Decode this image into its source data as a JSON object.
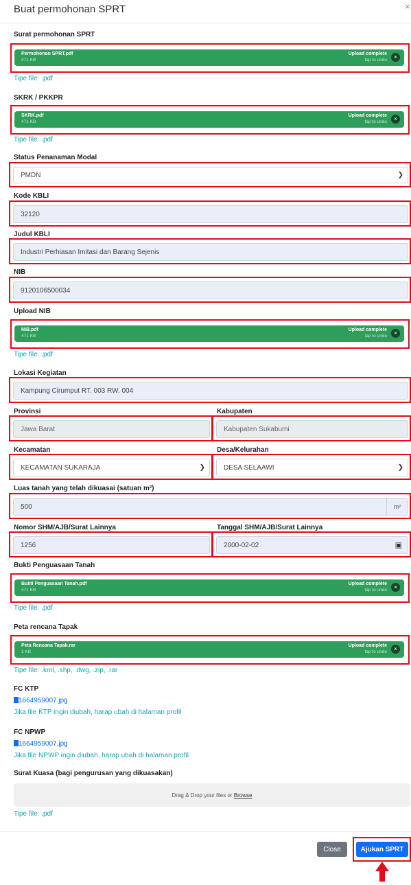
{
  "modal": {
    "title": "Buat permohonan SPRT",
    "close_glyph": "×"
  },
  "upload_status": "Upload complete",
  "undo_text": "tap to undo",
  "remove_glyph": "×",
  "surat": {
    "label": "Surat permohonan SPRT",
    "file": "Permohonan SPRT.pdf",
    "size": "471 KB",
    "hint": "Tipe file: .pdf"
  },
  "skrk": {
    "label": "SKRK / PKKPR",
    "file": "SKRK.pdf",
    "size": "471 KB",
    "hint": "Tipe file: .pdf"
  },
  "status_modal": {
    "label": "Status Penanaman Modal",
    "value": "PMDN"
  },
  "kode_kbli": {
    "label": "Kode KBLI",
    "value": "32120"
  },
  "judul_kbli": {
    "label": "Judul KBLI",
    "value": "Industri Perhiasan Imitasi dan Barang Sejenis"
  },
  "nib": {
    "label": "NIB",
    "value": "9120106500034"
  },
  "upload_nib": {
    "label": "Upload NIB",
    "file": "NIB.pdf",
    "size": "471 KB",
    "hint": "Tipe file: .pdf"
  },
  "lokasi": {
    "label": "Lokasi Kegiatan",
    "value": "Kampung Cirumput RT. 003 RW. 004"
  },
  "provinsi": {
    "label": "Provinsi",
    "value": "Jawa Barat"
  },
  "kabupaten": {
    "label": "Kabupaten",
    "value": "Kabupaten Sukabumi"
  },
  "kecamatan": {
    "label": "Kecamatan",
    "value": "KECAMATAN SUKARAJA"
  },
  "desa": {
    "label": "Desa/Kelurahan",
    "value": "DESA SELAAWI"
  },
  "luas": {
    "label": "Luas tanah yang telah dikuasai (satuan m²)",
    "value": "500",
    "unit": "m²"
  },
  "nomor_shm": {
    "label": "Nomor SHM/AJB/Surat Lainnya",
    "value": "1256"
  },
  "tanggal_shm": {
    "label": "Tanggal SHM/AJB/Surat Lainnya",
    "value": "2000-02-02"
  },
  "bukti": {
    "label": "Bukti Penguasaan Tanah",
    "file": "Bukti Penguasaan Tanah.pdf",
    "size": "471 KB",
    "hint": "Tipe file: .pdf"
  },
  "peta": {
    "label": "Peta rencana Tapak",
    "file": "Peta Rencana Tapak.rar",
    "size": "1 KB",
    "hint": "Tipe file: .kml, .shp, .dwg, .zip, .rar"
  },
  "fc_ktp": {
    "label": "FC KTP",
    "file": "1664959007.jpg",
    "note": "Jika file KTP ingin diubah, harap ubah di halaman profil"
  },
  "fc_npwp": {
    "label": "FC NPWP",
    "file": "1664959007.jpg",
    "note": "Jika file NPWP ingin diubah, harap ubah di halaman profil"
  },
  "surat_kuasa": {
    "label": "Surat Kuasa (bagi pengurusan yang dikuasakan)",
    "drop_text": "Drag & Drop your files or",
    "browse": "Browse",
    "hint": "Tipe file: .pdf"
  },
  "footer": {
    "close_label": "Close",
    "submit_label": "Ajukan SPRT"
  },
  "colors": {
    "highlight": "#e30b17",
    "success": "#2e9e5b",
    "primary": "#0d6efd",
    "hint": "#17a2b8"
  }
}
